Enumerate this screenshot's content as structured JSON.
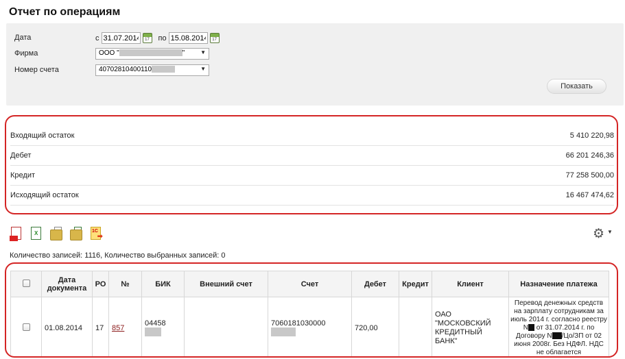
{
  "page": {
    "title": "Отчет по операциям"
  },
  "filters": {
    "date_label": "Дата",
    "from_prefix": "с",
    "from_date": "31.07.2014",
    "to_prefix": "по",
    "to_date": "15.08.2014",
    "calendar_day": "17",
    "firm_label": "Фирма",
    "firm_value_prefix": "ООО \"",
    "firm_value_suffix": "\"",
    "account_label": "Номер счета",
    "account_value_prefix": "40702810400110",
    "show_button": "Показать"
  },
  "summary": [
    {
      "label": "Входящий остаток",
      "value": "5 410 220,98"
    },
    {
      "label": "Дебет",
      "value": "66 201 246,36"
    },
    {
      "label": "Кредит",
      "value": "77 258 500,00"
    },
    {
      "label": "Исходящий остаток",
      "value": "16 467 474,62"
    }
  ],
  "toolbar": {
    "icons": [
      "pdf-export-icon",
      "excel-export-icon",
      "folder-pdf-icon",
      "folder-xls-icon",
      "export-1c-icon"
    ],
    "xls_badge": "X",
    "onec_badge": "1С",
    "settings_icon": "gear-icon"
  },
  "records": {
    "text": "Количество записей: 1116, Количество выбранных записей: 0"
  },
  "table": {
    "headers": {
      "date": "Дата документа",
      "ro": "РО",
      "num": "№",
      "bik": "БИК",
      "ext_account": "Внешний счет",
      "account": "Счет",
      "debit": "Дебет",
      "credit": "Кредит",
      "client": "Клиент",
      "purpose": "Назначение платежа"
    },
    "rows": [
      {
        "date": "01.08.2014",
        "ro": "17",
        "num": "857",
        "bik": "04458",
        "ext_account": "",
        "account": "7060181030000",
        "debit": "720,00",
        "credit": "",
        "client": "ОАО \"МОСКОВСКИЙ КРЕДИТНЫЙ БАНК\"",
        "purpose_1": "Перевод денежных средств на зарплату сотрудникам за июль 2014 г. согласно реестру N",
        "purpose_2": " от 31.07.2014 г. по Договору N",
        "purpose_3": "/Цо/ЗП от 02 июня 2008г. Без НДФЛ. НДС не облагается"
      }
    ]
  }
}
